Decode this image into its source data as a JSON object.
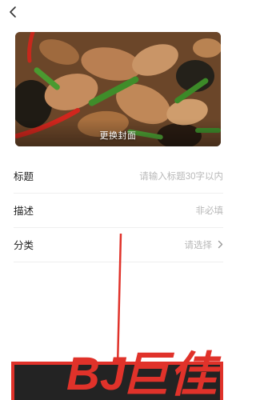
{
  "header": {
    "back_icon": "chevron-left-icon"
  },
  "cover": {
    "change_label": "更换封面"
  },
  "form": {
    "title": {
      "label": "标题",
      "placeholder": "请输入标题30字以内"
    },
    "description": {
      "label": "描述",
      "placeholder": "非必填"
    },
    "category": {
      "label": "分类",
      "placeholder": "请选择",
      "icon": "chevron-right-icon"
    }
  },
  "watermark": {
    "text": "BJ巨佳"
  },
  "colors": {
    "accent_red": "#e0322a",
    "hint_gray": "#b8b8b8",
    "bottom_bar": "#232323"
  }
}
